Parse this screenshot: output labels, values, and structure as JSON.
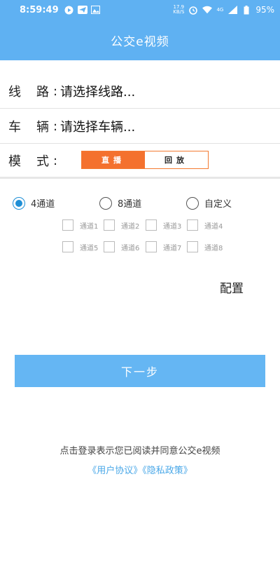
{
  "status_bar": {
    "time": "8:59:49",
    "net_speed_value": "17.9",
    "net_speed_unit": "KB/S",
    "network_type": "4G",
    "battery": "95%"
  },
  "header": {
    "title": "公交e视频"
  },
  "form": {
    "route": {
      "label_a": "线",
      "label_b": "路",
      "colon": ":",
      "value": "请选择线路..."
    },
    "vehicle": {
      "label_a": "车",
      "label_b": "辆",
      "colon": ":",
      "value": "请选择车辆..."
    },
    "mode": {
      "label_a": "模",
      "label_b": "式",
      "colon": ":",
      "live": "直播",
      "playback": "回放",
      "selected": "直播"
    }
  },
  "channel_modes": {
    "options": [
      "4通道",
      "8通道",
      "自定义"
    ],
    "selected": "4通道"
  },
  "channels": [
    "通道1",
    "通道2",
    "通道3",
    "通道4",
    "通道5",
    "通道6",
    "通道7",
    "通道8"
  ],
  "config_label": "配置",
  "next_button": "下一步",
  "notice": "点击登录表示您已阅读并同意公交e视频",
  "agreements": {
    "user": "《用户协议》",
    "privacy": "《隐私政策》"
  },
  "colors": {
    "primary": "#5fb1f2",
    "accent": "#f4712e",
    "link": "#4aa8e8",
    "radio": "#1f8fd6"
  }
}
